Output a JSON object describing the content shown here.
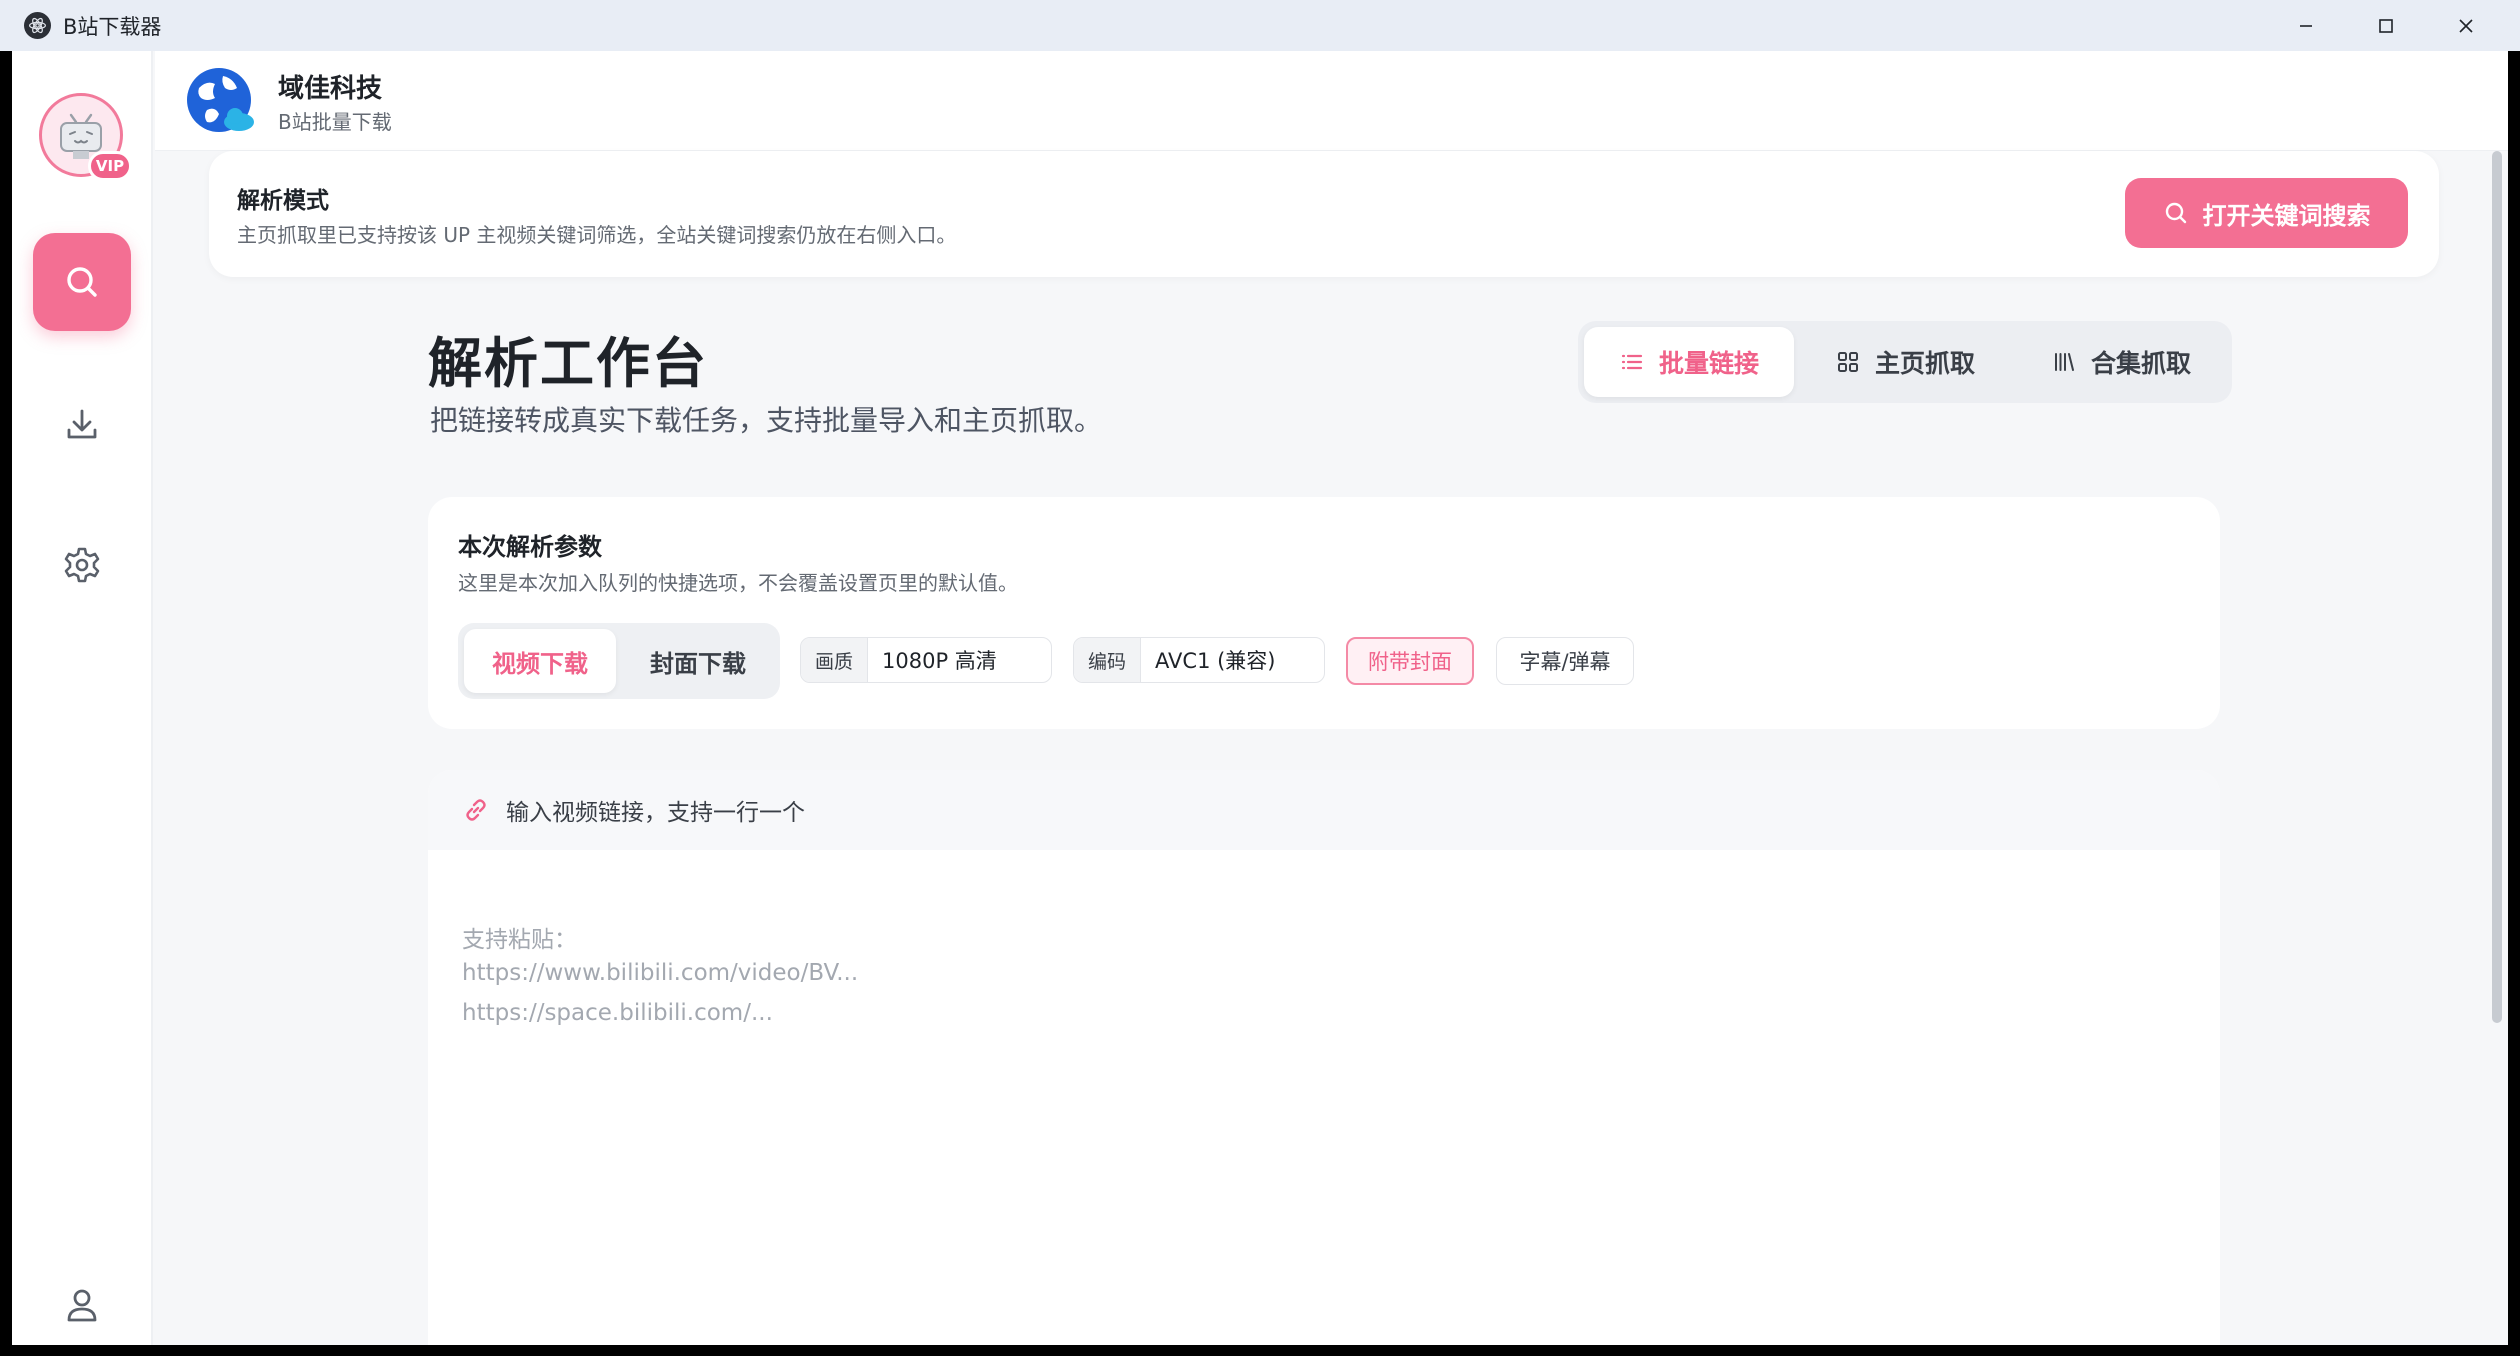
{
  "window": {
    "title": "B站下载器"
  },
  "sidebar": {
    "vip_badge": "VIP"
  },
  "header": {
    "brand_name": "域佳科技",
    "brand_sub": "B站批量下载"
  },
  "banner": {
    "title": "解析模式",
    "desc": "主页抓取里已支持按该 UP 主视频关键词筛选，全站关键词搜索仍放在右侧入口。",
    "button": "打开关键词搜索"
  },
  "workbench": {
    "title": "解析工作台",
    "subtitle": "把链接转成真实下载任务，支持批量导入和主页抓取。",
    "tabs": [
      {
        "label": "批量链接",
        "active": true
      },
      {
        "label": "主页抓取",
        "active": false
      },
      {
        "label": "合集抓取",
        "active": false
      }
    ]
  },
  "params": {
    "title": "本次解析参数",
    "desc": "这里是本次加入队列的快捷选项，不会覆盖设置页里的默认值。",
    "download_modes": [
      {
        "label": "视频下载",
        "active": true
      },
      {
        "label": "封面下载",
        "active": false
      }
    ],
    "quality": {
      "label": "画质",
      "value": "1080P 高清"
    },
    "codec": {
      "label": "编码",
      "value": "AVC1 (兼容)"
    },
    "toggles": [
      {
        "label": "附带封面",
        "on": true
      },
      {
        "label": "字幕/弹幕",
        "on": false
      }
    ]
  },
  "links": {
    "header": "输入视频链接，支持一行一个",
    "placeholder_lines": [
      "支持粘贴：",
      "https://www.bilibili.com/video/BV...",
      "https://space.bilibili.com/..."
    ]
  },
  "colors": {
    "accent": "#f36f93",
    "accent_text": "#f0628a"
  }
}
